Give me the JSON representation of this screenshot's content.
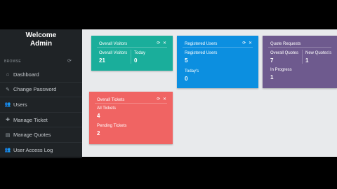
{
  "sidebar": {
    "welcome_line1": "Welcome",
    "welcome_line2": "Admin",
    "browse_label": "BROWSE",
    "items": [
      {
        "label": "Dashboard",
        "icon": "home-icon"
      },
      {
        "label": "Change Password",
        "icon": "edit-icon"
      },
      {
        "label": "Users",
        "icon": "users-icon"
      },
      {
        "label": "Manage Ticket",
        "icon": "ticket-icon"
      },
      {
        "label": "Manage Quotes",
        "icon": "list-icon"
      },
      {
        "label": "User Access Log",
        "icon": "users-icon"
      }
    ]
  },
  "cards": {
    "visitors": {
      "title": "Overall Visitors",
      "overall_label": "Overall Visitors",
      "overall_value": "21",
      "today_label": "Today",
      "today_value": "0"
    },
    "registered": {
      "title": "Registered Users",
      "registered_label": "Registered Users",
      "registered_value": "5",
      "todays_label": "Today's",
      "todays_value": "0"
    },
    "quotes": {
      "title": "Quote Requests",
      "overall_label": "Overall Quotes",
      "overall_value": "7",
      "new_label": "New Quotes's",
      "new_value": "1",
      "progress_label": "In Progress",
      "progress_value": "1"
    },
    "tickets": {
      "title": "Overall Tickets",
      "all_label": "All Tickets",
      "all_value": "4",
      "pending_label": "Pending Tickets",
      "pending_value": "2"
    }
  },
  "colors": {
    "green": "#1aae9b",
    "blue": "#0c8fe0",
    "purple": "#6e5a8e",
    "red": "#f06463",
    "sidebar": "#1f2326"
  }
}
